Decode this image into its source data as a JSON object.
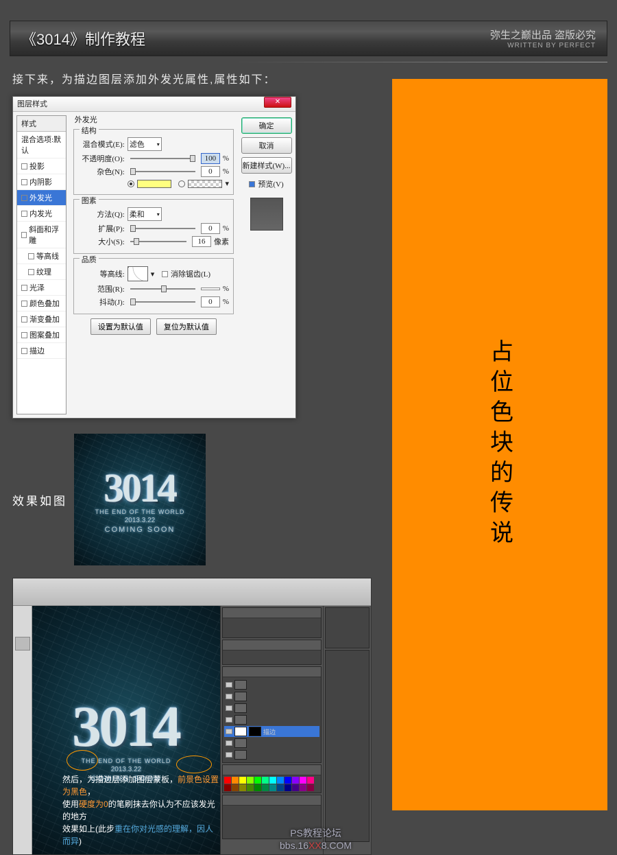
{
  "header": {
    "title": "《3014》制作教程",
    "sub1": "弥生之巅出品  盗版必究",
    "sub2": "WRITTEN BY PERFECT"
  },
  "instr1": "接下来，为描边图层添加外发光属性,属性如下：",
  "dialog": {
    "title": "图层样式",
    "close": "✕",
    "left_header": "样式",
    "left_blend": "混合选项:默认",
    "styles": [
      {
        "label": "投影",
        "chk": false
      },
      {
        "label": "内阴影",
        "chk": false
      },
      {
        "label": "外发光",
        "chk": true,
        "active": true
      },
      {
        "label": "内发光",
        "chk": false
      },
      {
        "label": "斜面和浮雕",
        "chk": false
      },
      {
        "label": "等高线",
        "chk": false,
        "sub": true
      },
      {
        "label": "纹理",
        "chk": false,
        "sub": true
      },
      {
        "label": "光泽",
        "chk": false
      },
      {
        "label": "颜色叠加",
        "chk": false
      },
      {
        "label": "渐变叠加",
        "chk": false
      },
      {
        "label": "图案叠加",
        "chk": false
      },
      {
        "label": "描边",
        "chk": false
      }
    ],
    "section_title": "外发光",
    "g1": "结构",
    "blend_label": "混合模式(E):",
    "blend_val": "滤色",
    "opac_label": "不透明度(O):",
    "opac_val": "100",
    "pct": "%",
    "noise_label": "杂色(N):",
    "noise_val": "0",
    "g2": "图素",
    "method_label": "方法(Q):",
    "method_val": "柔和",
    "spread_label": "扩展(P):",
    "spread_val": "0",
    "size_label": "大小(S):",
    "size_val": "16",
    "px": "像素",
    "g3": "品质",
    "contour_label": "等高线:",
    "anti": "消除锯齿(L)",
    "range_label": "范围(R):",
    "range_val": "",
    "jitter_label": "抖动(J):",
    "jitter_val": "0",
    "btn_def": "设置为默认值",
    "btn_reset": "复位为默认值",
    "ok": "确定",
    "cancel": "取消",
    "newstyle": "新建样式(W)...",
    "preview": "预览(V)"
  },
  "result_label": "效果如图",
  "poster": {
    "num": "3014",
    "t1": "THE END OF THE WORLD",
    "t2": "2013.3.22",
    "t3": "COMING SOON"
  },
  "caption": {
    "l1a": "然后，为描边层添加图层蒙板，",
    "l1b": "前景色设置为黑色",
    "l1c": "，",
    "l2a": "使用",
    "l2b": "硬度为0",
    "l2c": "的笔刷抹去你认为不应该发光的地方",
    "l3a": "效果如上(此步",
    "l3b": "重在你对光感的理解，因人而异",
    "l3c": ")"
  },
  "sidebar": "占位色块的传说",
  "watermark": {
    "l1": "PS教程论坛",
    "l2a": "bbs.16",
    "l2b": "XX",
    "l2c": "8.COM"
  }
}
